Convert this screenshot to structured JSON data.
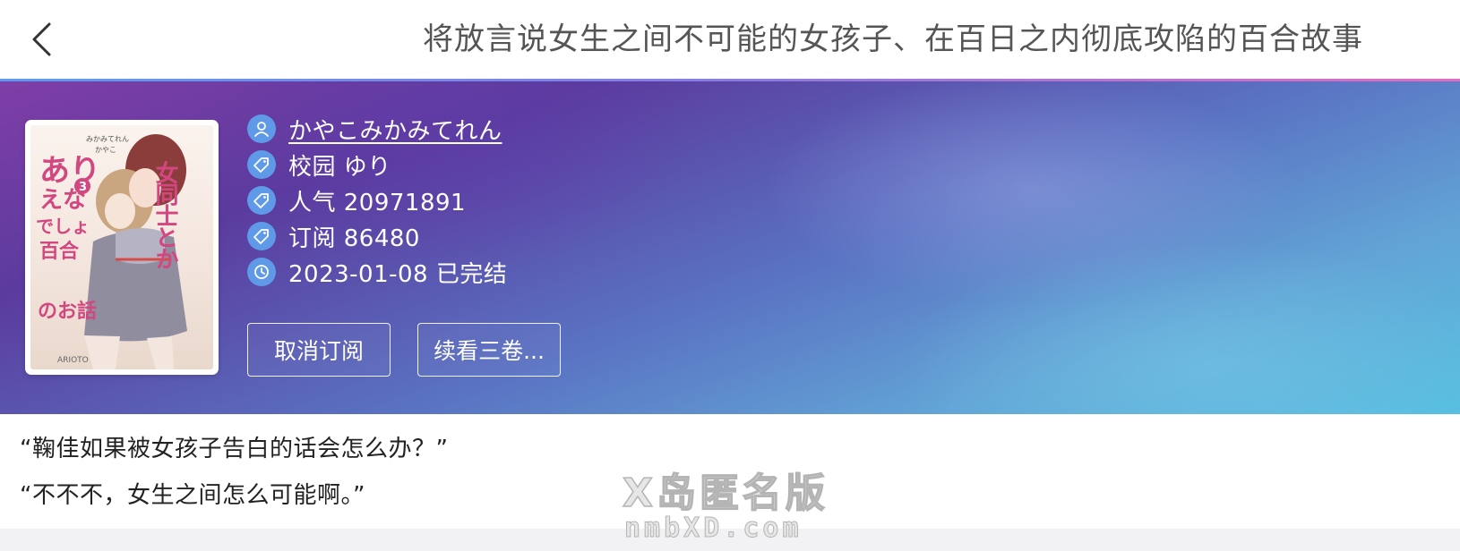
{
  "header": {
    "back_icon": "chevron-left-icon",
    "title": "将放言说女生之间不可能的女孩子、在百日之内彻底攻陷的百合故事"
  },
  "book": {
    "author": "かやこみかみてれん",
    "tags": "校园 ゆり",
    "popularity": "人气 20971891",
    "subscriptions": "订阅 86480",
    "date_status": "2023-01-08 已完结",
    "icons": {
      "author": "user-icon",
      "tags": "tag-icon",
      "popularity": "tag-icon",
      "subscriptions": "tag-icon",
      "date": "clock-icon"
    },
    "cover": {
      "title_jp_line1": "女同士とか",
      "title_jp_line2": "ありえないでしょ",
      "volume": "3",
      "subtitle_jp": "百合のお話",
      "credit_top": "みかみてれん",
      "credit_illust": "かやこ",
      "publisher": "ARIOTO"
    }
  },
  "actions": {
    "unsubscribe": "取消订阅",
    "continue_reading": "续看三卷..."
  },
  "content": {
    "line1": "“鞠佳如果被女孩子告白的话会怎么办？”",
    "line2": "“不不不，女生之间怎么可能啊。”"
  },
  "watermark": {
    "line1": "X岛匿名版",
    "line2": "nmbXD.com"
  },
  "colors": {
    "icon_circle": "#5f9ae8",
    "hero_top_left": "#7f3ea7",
    "hero_bottom_right": "#55bfe0",
    "accent_line_start": "#5a9df0",
    "accent_line_end": "#e46cc0"
  }
}
